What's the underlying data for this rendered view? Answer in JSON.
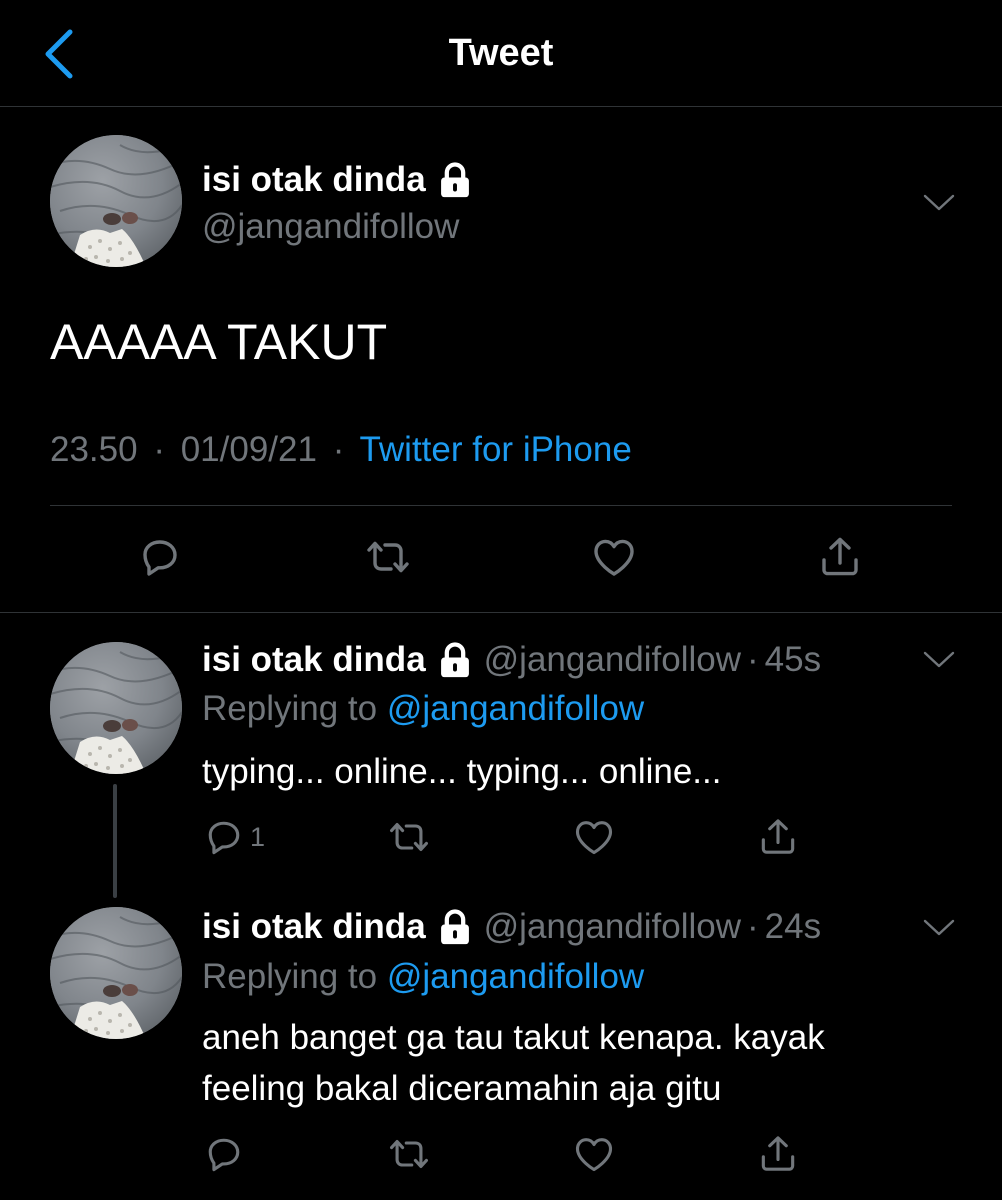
{
  "nav": {
    "title": "Tweet"
  },
  "main_tweet": {
    "author": "isi otak dinda",
    "handle": "@jangandifollow",
    "text": "AAAAA TAKUT",
    "time": "23.50",
    "date": "01/09/21",
    "source": "Twitter for iPhone"
  },
  "replies": [
    {
      "author": "isi otak dinda",
      "handle": "@jangandifollow",
      "age": "45s",
      "replying_prefix": "Replying to",
      "replying_to": "@jangandifollow",
      "text": "typing... online... typing... online...",
      "reply_count": "1"
    },
    {
      "author": "isi otak dinda",
      "handle": "@jangandifollow",
      "age": "24s",
      "replying_prefix": "Replying to",
      "replying_to": "@jangandifollow",
      "text": "aneh banget ga tau takut kenapa. kayak feeling bakal diceramahin aja gitu"
    }
  ],
  "colors": {
    "background": "#000000",
    "accent": "#1d9bf0",
    "muted": "#71767b",
    "divider": "#2f3336"
  },
  "icons": [
    "back-chevron-icon",
    "lock-icon",
    "chevron-down-icon",
    "reply-icon",
    "retweet-icon",
    "like-icon",
    "share-icon"
  ],
  "separator": "·"
}
